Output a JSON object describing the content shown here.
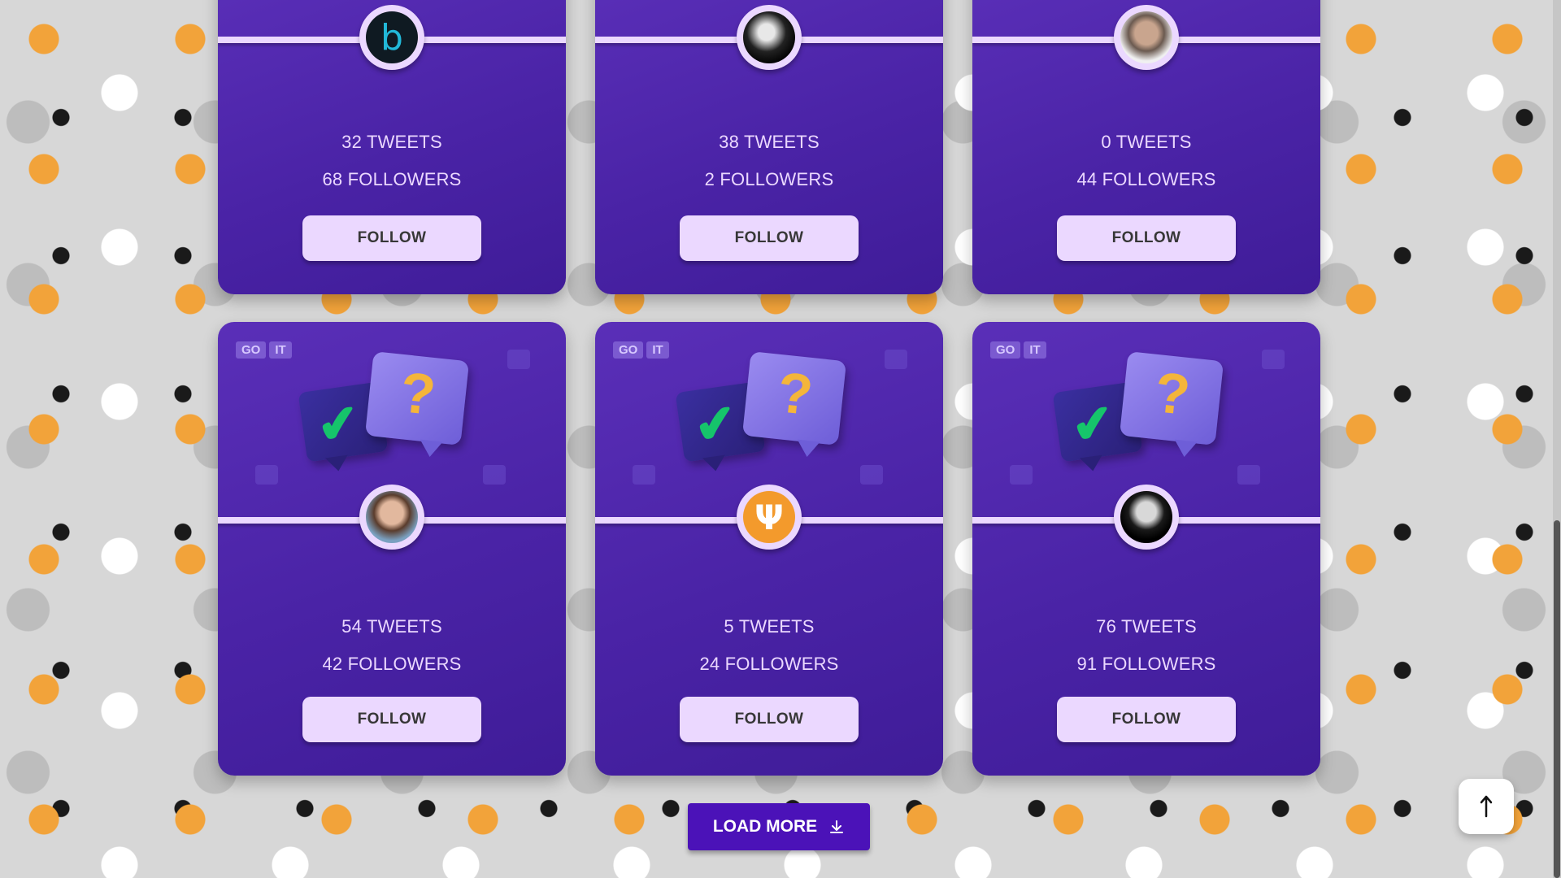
{
  "brand": {
    "logo_go": "GO",
    "logo_it": "IT"
  },
  "cards": [
    {
      "tweets": "32 TWEETS",
      "followers": "68 FOLLOWERS",
      "follow_label": "FOLLOW",
      "avatar_icon": "bulb-b-logo-icon",
      "avatar_text": "b"
    },
    {
      "tweets": "38 TWEETS",
      "followers": "2 FOLLOWERS",
      "follow_label": "FOLLOW",
      "avatar_icon": "user-photo-icon",
      "avatar_text": ""
    },
    {
      "tweets": "0 TWEETS",
      "followers": "44 FOLLOWERS",
      "follow_label": "FOLLOW",
      "avatar_icon": "user-photo-icon",
      "avatar_text": ""
    },
    {
      "tweets": "54 TWEETS",
      "followers": "42 FOLLOWERS",
      "follow_label": "FOLLOW",
      "avatar_icon": "user-photo-icon",
      "avatar_text": ""
    },
    {
      "tweets": "5 TWEETS",
      "followers": "24 FOLLOWERS",
      "follow_label": "FOLLOW",
      "avatar_icon": "cactus-logo-icon",
      "avatar_text": "Ψ"
    },
    {
      "tweets": "76 TWEETS",
      "followers": "91 FOLLOWERS",
      "follow_label": "FOLLOW",
      "avatar_icon": "user-photo-icon",
      "avatar_text": ""
    }
  ],
  "load_more": {
    "label": "LOAD MORE",
    "icon": "download-icon"
  },
  "scroll_top": {
    "icon": "arrow-up-icon"
  },
  "colors": {
    "card": "#4a23a6",
    "accent": "#ebd8ff",
    "button_text": "#373737",
    "load_more": "#4b12b8"
  }
}
